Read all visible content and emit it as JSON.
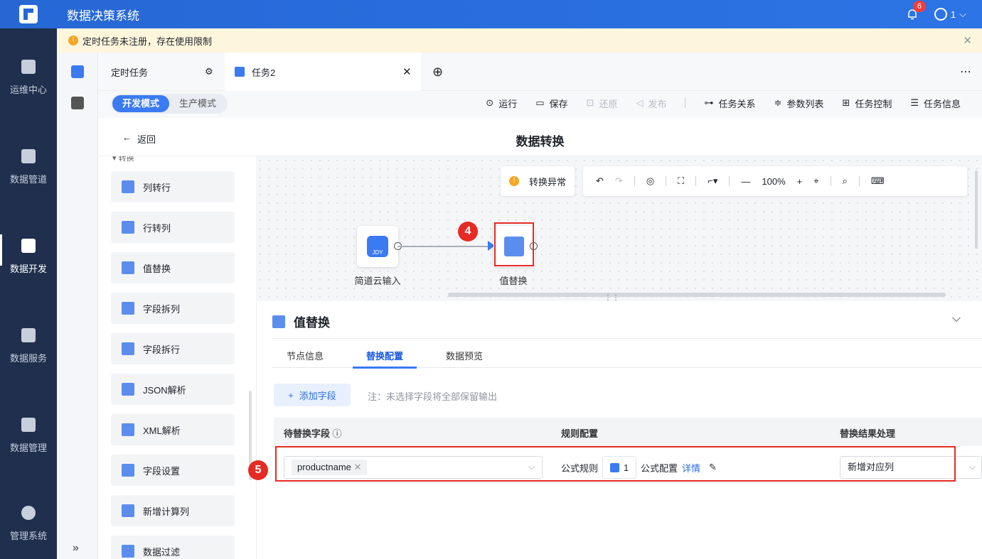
{
  "app": {
    "title": "数据决策系统",
    "notification_count": "6",
    "user_name": "1"
  },
  "nav": [
    {
      "label": "运维中心"
    },
    {
      "label": "数据管道"
    },
    {
      "label": "数据开发"
    },
    {
      "label": "数据服务"
    },
    {
      "label": "数据管理"
    },
    {
      "label": "管理系统"
    }
  ],
  "banner": {
    "text": "定时任务未注册，存在使用限制",
    "close": "✕"
  },
  "tabs": {
    "scheduled": "定时任务",
    "task2": "任务2"
  },
  "modes": {
    "dev": "开发模式",
    "prod": "生产模式"
  },
  "toolbar": {
    "run": "运行",
    "save": "保存",
    "restore": "还原",
    "publish": "发布",
    "relation": "任务关系",
    "params": "参数列表",
    "control": "任务控制",
    "info": "任务信息"
  },
  "header": {
    "back": "返回",
    "title": "数据转换"
  },
  "palette": {
    "section": "▾ 转换",
    "items": [
      "列转行",
      "行转列",
      "值替换",
      "字段拆列",
      "字段拆行",
      "JSON解析",
      "XML解析",
      "字段设置",
      "新增计算列",
      "数据过滤"
    ]
  },
  "canvas": {
    "warning": "转换异常",
    "zoom": "100%",
    "node1_label": "简道云输入",
    "node1_badge": "JDY",
    "node2_label": "值替换",
    "step4": "4"
  },
  "panel": {
    "title": "值替换",
    "tabs": [
      "节点信息",
      "替换配置",
      "数据预览"
    ],
    "add_field": "添加字段",
    "note": "注：未选择字段将全部保留输出",
    "columns": [
      "待替换字段",
      "规则配置",
      "替换结果处理"
    ],
    "row": {
      "field": "productname",
      "rule_label": "公式规则",
      "rule_count": "1",
      "formula_config": "公式配置",
      "details": "详情",
      "result": "新增对应列"
    },
    "step5": "5"
  },
  "colors": {
    "primary": "#2b6de6",
    "topbar": "#2667d4",
    "nav": "#1f2f4d",
    "warning": "#f5a623",
    "highlight": "#e52b24"
  }
}
